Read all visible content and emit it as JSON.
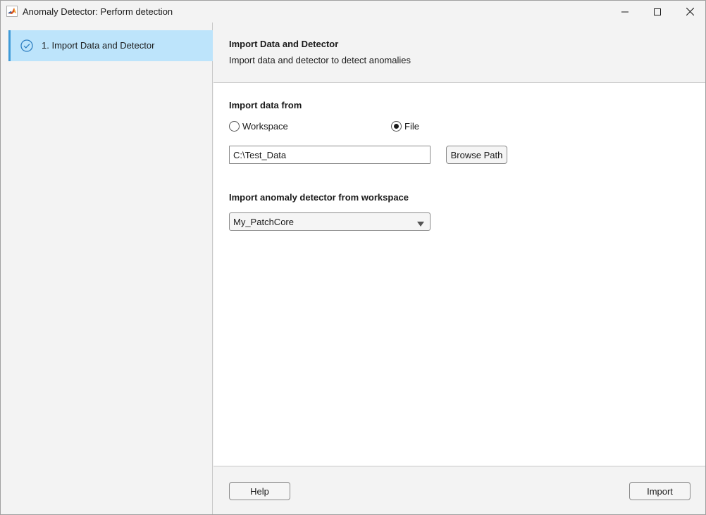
{
  "window": {
    "title": "Anomaly Detector: Perform detection",
    "app_icon": "matlab-icon"
  },
  "title_bar_buttons": {
    "minimize_icon": "minimize-icon",
    "maximize_icon": "maximize-icon",
    "close_icon": "close-icon"
  },
  "sidebar": {
    "steps": [
      {
        "label": "1. Import Data and Detector",
        "icon": "check-circle-icon",
        "selected": true
      }
    ]
  },
  "header": {
    "title": "Import Data and Detector",
    "subtitle": "Import data and detector to detect anomalies"
  },
  "data_section": {
    "label": "Import data from",
    "options": [
      {
        "label": "Workspace",
        "checked": false
      },
      {
        "label": "File",
        "checked": true
      }
    ],
    "path_value": "C:\\Test_Data",
    "browse_label": "Browse Path"
  },
  "detector_section": {
    "label": "Import anomaly detector from workspace",
    "selected": "My_PatchCore",
    "arrow_icon": "dropdown-arrow-icon"
  },
  "footer": {
    "help_label": "Help",
    "import_label": "Import"
  },
  "colors": {
    "selected_step_bg": "#bde4fb",
    "selected_step_accent": "#3f9bd8",
    "check_icon": "#2f7fc1",
    "panel_bg": "#f3f3f3"
  }
}
